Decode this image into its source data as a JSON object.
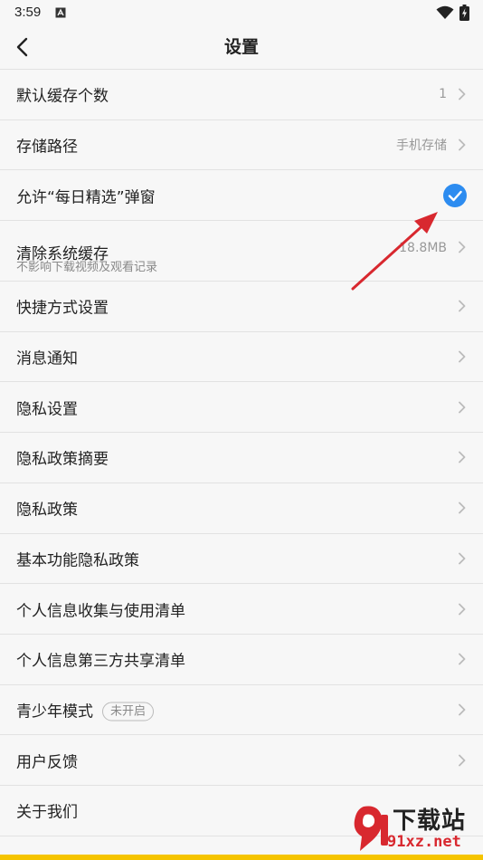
{
  "status_bar": {
    "time": "3:59",
    "app_icon": "app-notification-icon",
    "wifi_icon": "wifi-icon",
    "battery_icon": "battery-charging-icon"
  },
  "header": {
    "back_icon": "back-arrow-icon",
    "title": "设置"
  },
  "settings": {
    "items": [
      {
        "label": "默认缓存个数",
        "value": "1",
        "control": "chevron"
      },
      {
        "label": "存储路径",
        "value": "手机存储",
        "control": "chevron"
      },
      {
        "label": "允许“每日精选”弹窗",
        "control": "checkbox",
        "checked": true
      },
      {
        "label": "清除系统缓存",
        "sub": "不影响下载视频及观看记录",
        "value": "18.8MB",
        "control": "chevron"
      },
      {
        "label": "快捷方式设置",
        "control": "chevron"
      },
      {
        "label": "消息通知",
        "control": "chevron"
      },
      {
        "label": "隐私设置",
        "control": "chevron"
      },
      {
        "label": "隐私政策摘要",
        "control": "chevron"
      },
      {
        "label": "隐私政策",
        "control": "chevron"
      },
      {
        "label": "基本功能隐私政策",
        "control": "chevron"
      },
      {
        "label": "个人信息收集与使用清单",
        "control": "chevron"
      },
      {
        "label": "个人信息第三方共享清单",
        "control": "chevron"
      },
      {
        "label": "青少年模式",
        "badge": "未开启",
        "control": "chevron"
      },
      {
        "label": "用户反馈",
        "control": "chevron"
      },
      {
        "label": "关于我们",
        "control": "none"
      }
    ]
  },
  "colors": {
    "accent_blue": "#2d8cf0",
    "annotation_red": "#d8282f",
    "bottom_bar": "#f5c400"
  },
  "watermark": {
    "title": "下载站",
    "url": "91xz.net"
  }
}
